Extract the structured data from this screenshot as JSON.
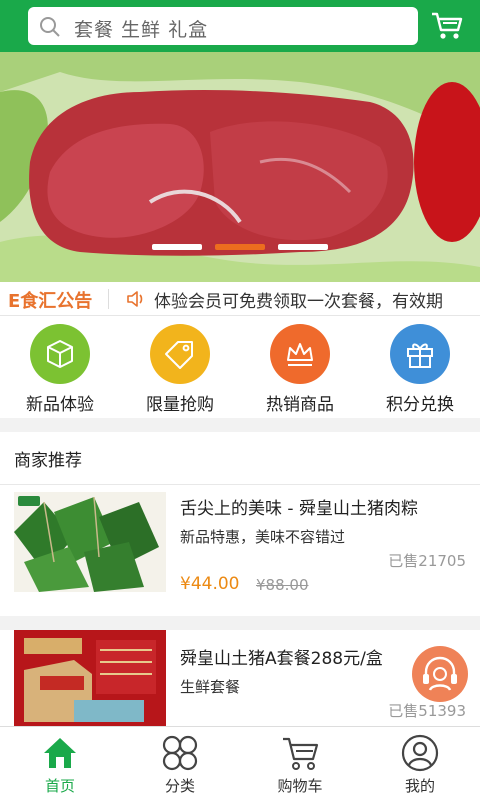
{
  "search": {
    "placeholder": "套餐  生鲜  礼盒"
  },
  "banner": {
    "slides": 3,
    "active_slide": 2
  },
  "notice": {
    "title": "E食汇公告",
    "text": "体验会员可免费领取一次套餐，有效期"
  },
  "categories": [
    {
      "label": "新品体验",
      "icon": "box-icon",
      "color": "#7cc232"
    },
    {
      "label": "限量抢购",
      "icon": "tag-icon",
      "color": "#f2b41c"
    },
    {
      "label": "热销商品",
      "icon": "crown-icon",
      "color": "#ef6a2c"
    },
    {
      "label": "积分兑换",
      "icon": "gift-icon",
      "color": "#3f8fd8"
    }
  ],
  "merchant": {
    "title": "商家推荐",
    "products": [
      {
        "name": "舌尖上的美味 - 舜皇山土猪肉粽",
        "subtitle": "新品特惠，美味不容错过",
        "sold": "已售21705",
        "price": "¥44.00",
        "old_price": "¥88.00"
      },
      {
        "name": "舜皇山土猪A套餐288元/盒",
        "subtitle": "生鲜套餐",
        "sold": "已售51393"
      }
    ]
  },
  "tabbar": {
    "items": [
      {
        "label": "首页",
        "icon": "home-icon",
        "active": true
      },
      {
        "label": "分类",
        "icon": "category-icon",
        "active": false
      },
      {
        "label": "购物车",
        "icon": "cart-icon",
        "active": false
      },
      {
        "label": "我的",
        "icon": "user-icon",
        "active": false
      }
    ]
  },
  "colors": {
    "brand": "#1aa94a",
    "accent": "#ec6d1e",
    "price": "#ec8a14"
  }
}
